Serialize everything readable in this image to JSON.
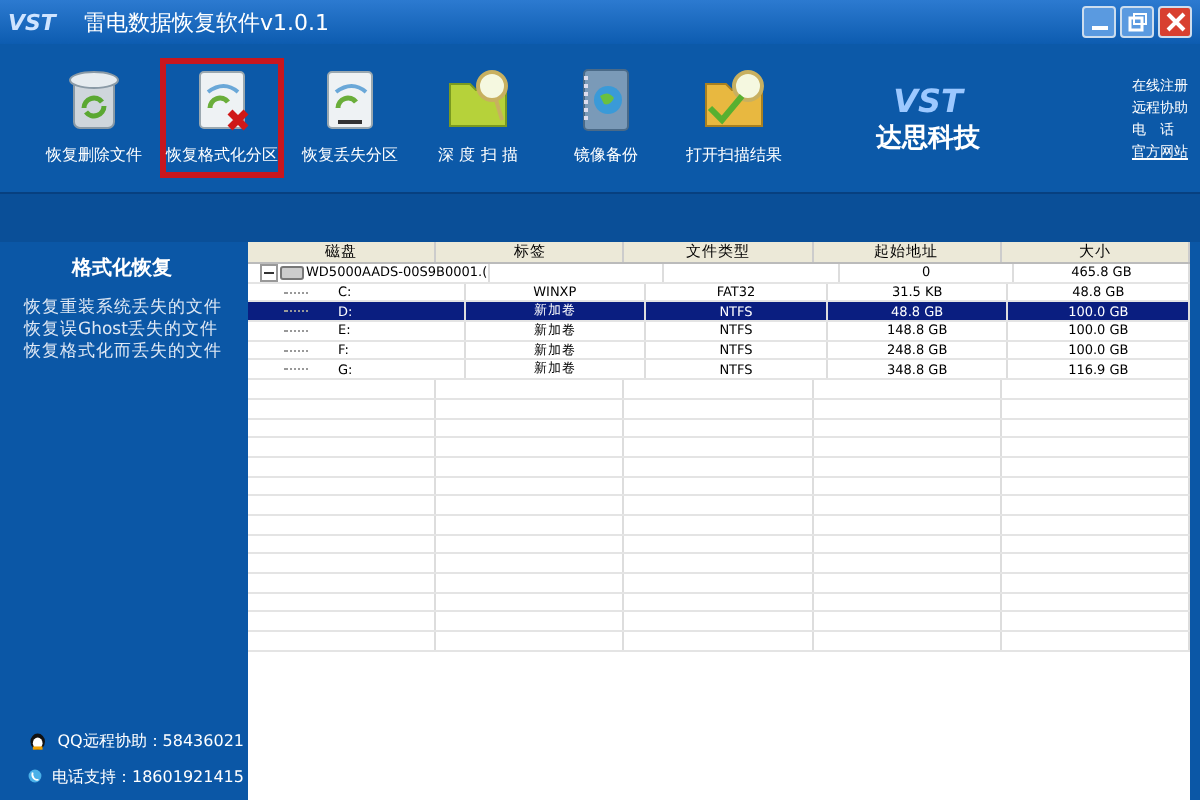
{
  "window": {
    "logo": "VST",
    "title": "雷电数据恢复软件v1.0.1"
  },
  "toolbar": [
    {
      "label": "恢复删除文件",
      "kind": "bin",
      "selected": false
    },
    {
      "label": "恢复格式化分区",
      "kind": "disk-x",
      "selected": true
    },
    {
      "label": "恢复丢失分区",
      "kind": "disk",
      "selected": false
    },
    {
      "label": "深 度 扫 描",
      "kind": "folder-scan",
      "selected": false
    },
    {
      "label": "镜像备份",
      "kind": "book",
      "selected": false
    },
    {
      "label": "打开扫描结果",
      "kind": "folder-check",
      "selected": false
    }
  ],
  "brand": {
    "logo": "VST",
    "name": "达思科技"
  },
  "links": [
    "在线注册",
    "远程协助",
    "电　话",
    "官方网站"
  ],
  "sidebar": {
    "title": "格式化恢复",
    "items": [
      "恢复重装系统丢失的文件",
      "恢复误Ghost丢失的文件",
      "恢复格式化而丢失的文件"
    ],
    "contacts": [
      {
        "kind": "qq",
        "text": "QQ远程协助：58436021"
      },
      {
        "kind": "phone",
        "text": "电话支持：18601921415"
      }
    ]
  },
  "table": {
    "columns": [
      "磁盘",
      "标签",
      "文件类型",
      "起始地址",
      "大小"
    ],
    "rows": [
      {
        "disk": "WD5000AADS-00S9B0001.(",
        "label": "",
        "type": "",
        "start": "0",
        "size": "465.8 GB",
        "expanded": true,
        "selected": false,
        "children": [
          {
            "disk": "C:",
            "label": "WINXP",
            "type": "FAT32",
            "start": "31.5 KB",
            "size": "48.8 GB",
            "selected": false
          },
          {
            "disk": "D:",
            "label": "新加卷",
            "type": "NTFS",
            "start": "48.8 GB",
            "size": "100.0 GB",
            "selected": true
          },
          {
            "disk": "E:",
            "label": "新加卷",
            "type": "NTFS",
            "start": "148.8 GB",
            "size": "100.0 GB",
            "selected": false
          },
          {
            "disk": "F:",
            "label": "新加卷",
            "type": "NTFS",
            "start": "248.8 GB",
            "size": "100.0 GB",
            "selected": false
          },
          {
            "disk": "G:",
            "label": "新加卷",
            "type": "NTFS",
            "start": "348.8 GB",
            "size": "116.9 GB",
            "selected": false
          }
        ]
      }
    ]
  }
}
